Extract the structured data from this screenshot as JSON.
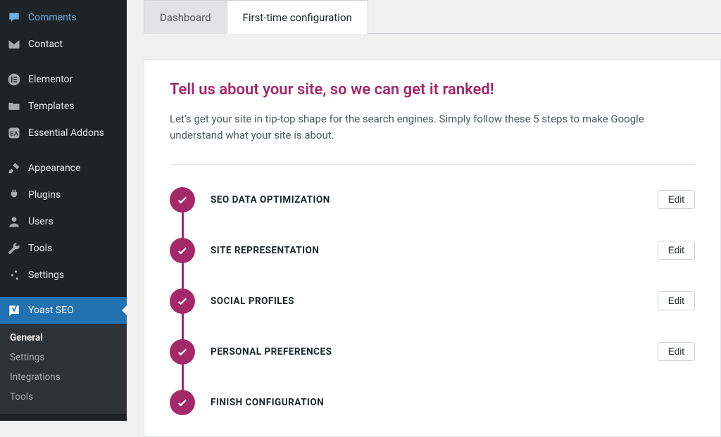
{
  "sidebar": {
    "items": [
      {
        "label": "Comments",
        "icon": "speech-bubble-icon",
        "kind": "comments"
      },
      {
        "label": "Contact",
        "icon": "envelope-icon"
      }
    ],
    "items2": [
      {
        "label": "Elementor",
        "icon": "elementor-icon"
      },
      {
        "label": "Templates",
        "icon": "folder-icon"
      },
      {
        "label": "Essential Addons",
        "icon": "ea-icon"
      }
    ],
    "items3": [
      {
        "label": "Appearance",
        "icon": "brush-icon"
      },
      {
        "label": "Plugins",
        "icon": "plug-icon"
      },
      {
        "label": "Users",
        "icon": "user-icon"
      },
      {
        "label": "Tools",
        "icon": "wrench-icon"
      },
      {
        "label": "Settings",
        "icon": "sliders-icon"
      }
    ],
    "yoast": {
      "label": "Yoast SEO",
      "submenu": [
        "General",
        "Settings",
        "Integrations",
        "Tools"
      ],
      "active_index": 0
    }
  },
  "tabs": {
    "items": [
      "Dashboard",
      "First-time configuration"
    ],
    "active_index": 1
  },
  "page": {
    "heading": "Tell us about your site, so we can get it ranked!",
    "lead": "Let's get your site in tip-top shape for the search engines. Simply follow these 5 steps to make Google understand what your site is about."
  },
  "steps": [
    {
      "title": "SEO DATA OPTIMIZATION",
      "edit": "Edit",
      "done": true
    },
    {
      "title": "SITE REPRESENTATION",
      "edit": "Edit",
      "done": true
    },
    {
      "title": "SOCIAL PROFILES",
      "edit": "Edit",
      "done": true
    },
    {
      "title": "PERSONAL PREFERENCES",
      "edit": "Edit",
      "done": true
    },
    {
      "title": "FINISH CONFIGURATION",
      "edit": "",
      "done": true
    }
  ],
  "edit_label": "Edit",
  "colors": {
    "accent": "#a4286a",
    "wp_blue": "#2271b1"
  }
}
